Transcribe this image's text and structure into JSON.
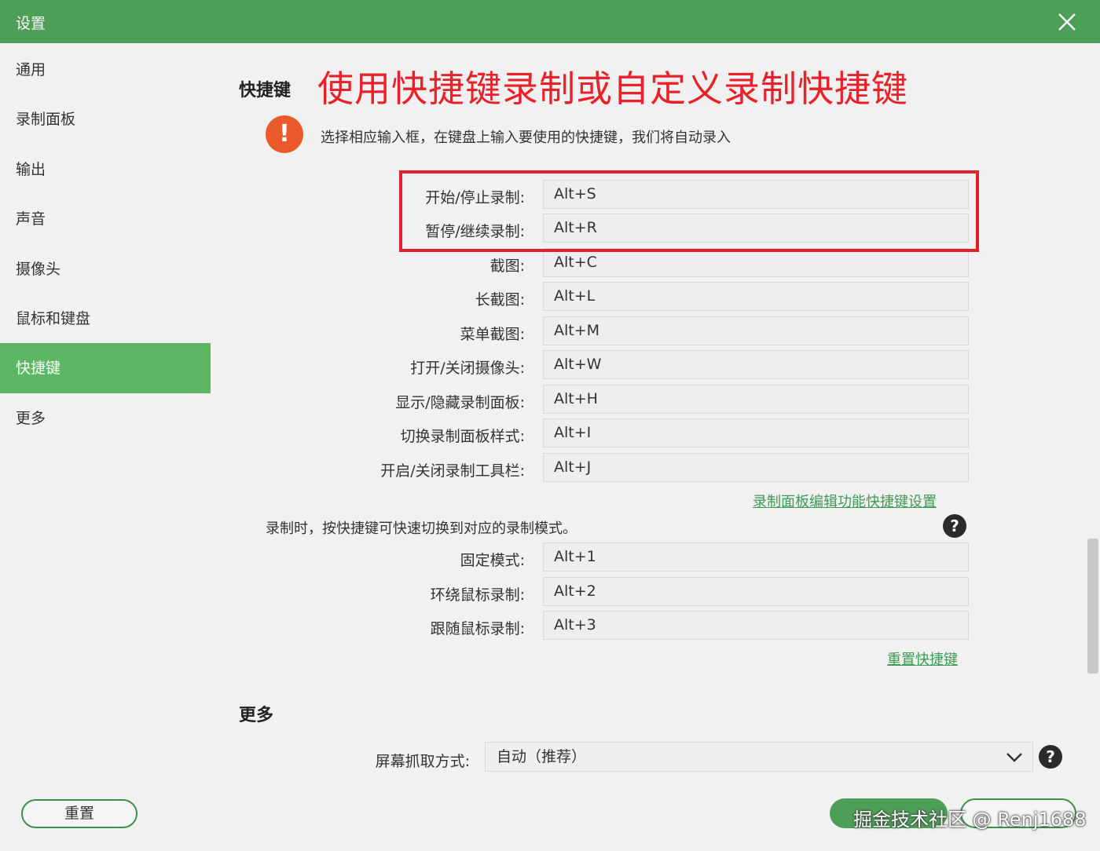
{
  "window": {
    "title": "设置"
  },
  "sidebar": {
    "items": [
      {
        "label": "通用"
      },
      {
        "label": "录制面板"
      },
      {
        "label": "输出"
      },
      {
        "label": "声音"
      },
      {
        "label": "摄像头"
      },
      {
        "label": "鼠标和键盘"
      },
      {
        "label": "快捷键",
        "active": true
      },
      {
        "label": "更多"
      }
    ]
  },
  "shortcuts": {
    "section_title": "快捷键",
    "headline": "使用快捷键录制或自定义录制快捷键",
    "hint": "选择相应输入框，在键盘上输入要使用的快捷键，我们将自动录入",
    "rows": [
      {
        "label": "开始/停止录制:",
        "value": "Alt+S"
      },
      {
        "label": "暂停/继续录制:",
        "value": "Alt+R"
      },
      {
        "label": "截图:",
        "value": "Alt+C"
      },
      {
        "label": "长截图:",
        "value": "Alt+L"
      },
      {
        "label": "菜单截图:",
        "value": "Alt+M"
      },
      {
        "label": "打开/关闭摄像头:",
        "value": "Alt+W"
      },
      {
        "label": "显示/隐藏录制面板:",
        "value": "Alt+H"
      },
      {
        "label": "切换录制面板样式:",
        "value": "Alt+I"
      },
      {
        "label": "开启/关闭录制工具栏:",
        "value": "Alt+J"
      }
    ],
    "panel_link": "录制面板编辑功能快捷键设置",
    "mode_note": "录制时，按快捷键可快速切换到对应的录制模式。",
    "mode_rows": [
      {
        "label": "固定模式:",
        "value": "Alt+1"
      },
      {
        "label": "环绕鼠标录制:",
        "value": "Alt+2"
      },
      {
        "label": "跟随鼠标录制:",
        "value": "Alt+3"
      }
    ],
    "reset_link": "重置快捷键"
  },
  "more": {
    "section_title": "更多",
    "capture_label": "屏幕抓取方式:",
    "capture_value": "自动（推荐）"
  },
  "footer": {
    "reset_label": "重置",
    "watermark": "掘金技术社区 @ Renj1688"
  },
  "colors": {
    "titlebar": "#4d9e56",
    "sidebar_active": "#5cb765",
    "headline": "#e8212a",
    "highlight_box": "#e0202a",
    "link": "#3e9a55",
    "warning": "#ea5a2a"
  },
  "icons": {
    "close": "close-icon",
    "warning": "exclamation-icon",
    "help": "question-icon",
    "dropdown": "chevron-down-icon"
  }
}
